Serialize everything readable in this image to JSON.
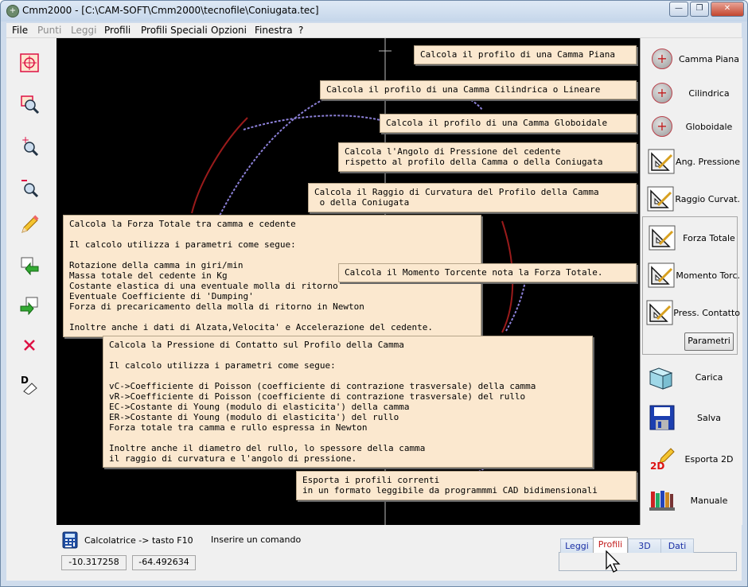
{
  "window": {
    "title": "Cmm2000 - [C:\\CAM-SOFT\\Cmm2000\\tecnofile\\Coniugata.tec]",
    "app_icon": "cmm-app-icon",
    "controls": {
      "minimize": "—",
      "restore": "❐",
      "close": "✕"
    }
  },
  "menubar": [
    {
      "label": "File",
      "enabled": true
    },
    {
      "label": "Punti",
      "enabled": false
    },
    {
      "label": "Leggi",
      "enabled": false
    },
    {
      "label": "Profili",
      "enabled": true
    },
    {
      "label": "Profili Speciali",
      "enabled": true
    },
    {
      "label": "Opzioni",
      "enabled": true
    },
    {
      "label": "Finestra",
      "enabled": true
    },
    {
      "label": "?",
      "enabled": true
    }
  ],
  "left_toolbar": [
    {
      "name": "center-view-icon"
    },
    {
      "name": "zoom-window-icon"
    },
    {
      "name": "zoom-in-icon"
    },
    {
      "name": "zoom-out-icon"
    },
    {
      "name": "pencil-icon"
    },
    {
      "name": "import-arrow-icon"
    },
    {
      "name": "export-arrow-icon"
    },
    {
      "name": "delete-x-icon"
    },
    {
      "name": "measure-distance-icon",
      "glyph": "D"
    }
  ],
  "tooltips": {
    "camma_piana": "Calcola il profilo di una Camma Piana",
    "cilindrica": "Calcola il profilo di una Camma Cilindrica o Lineare",
    "globoidale": "Calcola il profilo di una Camma Globoidale",
    "ang_pressione": "Calcola l'Angolo di Pressione del cedente\nrispetto al profilo della Camma o della Coniugata",
    "raggio_curvatura": "Calcola il Raggio di Curvatura del Profilo della Camma\n o della Coniugata",
    "forza_totale": "Calcola la Forza Totale tra camma e cedente\n\nIl calcolo utilizza i parametri come segue:\n\nRotazione della camma in giri/min\nMassa totale del cedente in Kg\nCostante elastica di una eventuale molla di ritorno\nEventuale Coefficiente di 'Dumping'\nForza di precaricamento della molla di ritorno in Newton\n\nInoltre anche i dati di Alzata,Velocita' e Accelerazione del cedente.",
    "momento_torcente": "Calcola il Momento Torcente nota la Forza Totale.",
    "pressione_contatto": "Calcola la Pressione di Contatto sul Profilo della Camma\n\nIl calcolo utilizza i parametri come segue:\n\nvC->Coefficiente di Poisson (coefficiente di contrazione trasversale) della camma\nvR->Coefficiente di Poisson (coefficiente di contrazione trasversale) del rullo\nEC->Costante di Young (modulo di elasticita') della camma\nER->Costante di Young (modulo di elasticita') del rullo\nForza totale tra camma e rullo espressa in Newton\n\nInoltre anche il diametro del rullo, lo spessore della camma\nil raggio di curvatura e l'angolo di pressione.",
    "esporta": "Esporta i profili correnti\nin un formato leggibile da programmmi CAD bidimensionali"
  },
  "right_panel": [
    {
      "key": "camma_piana",
      "label": "Camma Piana",
      "icon": "cam-circle-icon"
    },
    {
      "key": "cilindrica",
      "label": "Cilindrica",
      "icon": "cam-circle-icon"
    },
    {
      "key": "globoidale",
      "label": "Globoidale",
      "icon": "cam-circle-icon"
    },
    {
      "key": "ang_pressione",
      "label": "Ang. Pressione",
      "icon": "set-square-icon"
    },
    {
      "key": "raggio_curvatura",
      "label": "Raggio Curvat.",
      "icon": "set-square-icon"
    },
    {
      "key": "forza_totale",
      "label": "Forza Totale",
      "icon": "set-square-icon"
    },
    {
      "key": "momento_torcente",
      "label": "Momento Torc.",
      "icon": "set-square-icon"
    },
    {
      "key": "press_contatto",
      "label": "Press. Contatto",
      "icon": "set-square-icon"
    },
    {
      "key": "carica",
      "label": "Carica",
      "icon": "open-folder-icon"
    },
    {
      "key": "salva",
      "label": "Salva",
      "icon": "floppy-disk-icon"
    },
    {
      "key": "esporta_2d",
      "label": "Esporta 2D",
      "icon": "export-2d-icon",
      "icon_text": "2D"
    },
    {
      "key": "manuale",
      "label": "Manuale",
      "icon": "books-icon"
    }
  ],
  "parametri_button": "Parametri",
  "status": {
    "calculator": "Calcolatrice -> tasto F10",
    "command_prompt": "Inserire un comando",
    "coord_x": "-10.317258",
    "coord_y": "-64.492634"
  },
  "tabs": [
    {
      "label": "Leggi",
      "active": false
    },
    {
      "label": "Profili",
      "active": true
    },
    {
      "label": "3D",
      "active": false
    },
    {
      "label": "Dati",
      "active": false
    }
  ],
  "colors": {
    "canvas": "#000000",
    "profile_main": "#7b6fc4",
    "profile_conjugate": "#8b1a1a",
    "tooltip_bg": "#fbe8cf",
    "active_tab": "#c21c1c"
  }
}
